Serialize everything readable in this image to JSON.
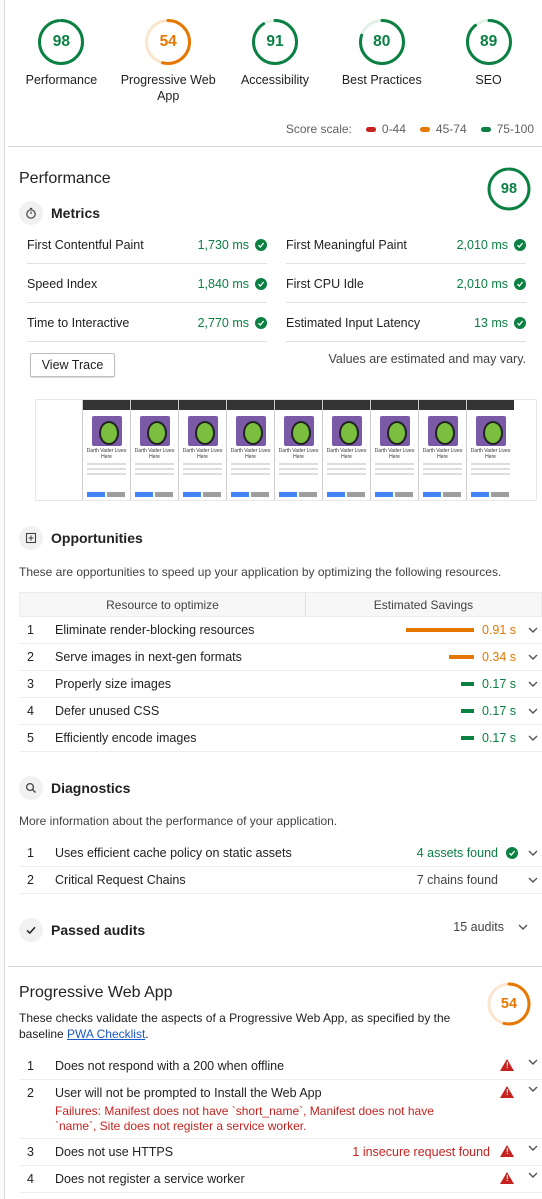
{
  "gauges": [
    {
      "score": "98",
      "label": "Performance",
      "color": "#0b8043",
      "pct": 0.98
    },
    {
      "score": "54",
      "label": "Progressive Web App",
      "color": "#e67700",
      "pct": 0.54
    },
    {
      "score": "91",
      "label": "Accessibility",
      "color": "#0b8043",
      "pct": 0.91
    },
    {
      "score": "80",
      "label": "Best Practices",
      "color": "#0b8043",
      "pct": 0.8
    },
    {
      "score": "89",
      "label": "SEO",
      "color": "#0b8043",
      "pct": 0.89
    }
  ],
  "scale": {
    "title": "Score scale:",
    "fail": "0-44",
    "average": "45-74",
    "pass": "75-100",
    "fail_color": "#c7221f",
    "average_color": "#e67700",
    "pass_color": "#0b8043"
  },
  "performance": {
    "title": "Performance",
    "score": "98",
    "pct": 0.98,
    "metrics_title": "Metrics",
    "metrics": [
      {
        "name": "First Contentful Paint",
        "value": "1,730 ms"
      },
      {
        "name": "First Meaningful Paint",
        "value": "2,010 ms"
      },
      {
        "name": "Speed Index",
        "value": "1,840 ms"
      },
      {
        "name": "First CPU Idle",
        "value": "2,010 ms"
      },
      {
        "name": "Time to Interactive",
        "value": "2,770 ms"
      },
      {
        "name": "Estimated Input Latency",
        "value": "13 ms"
      }
    ],
    "view_trace": "View Trace",
    "estimate_note": "Values are estimated and may vary.",
    "frame_title": "Darth Vader Lives Here"
  },
  "opportunities": {
    "title": "Opportunities",
    "desc": "These are opportunities to speed up your application by optimizing the following resources.",
    "col1": "Resource to optimize",
    "col2": "Estimated Savings",
    "items": [
      {
        "n": "1",
        "title": "Eliminate render-blocking resources",
        "saving": "0.91 s",
        "level": "average",
        "fraction": 1.0
      },
      {
        "n": "2",
        "title": "Serve images in next-gen formats",
        "saving": "0.34 s",
        "level": "average",
        "fraction": 0.37
      },
      {
        "n": "3",
        "title": "Properly size images",
        "saving": "0.17 s",
        "level": "pass",
        "fraction": 0.19
      },
      {
        "n": "4",
        "title": "Defer unused CSS",
        "saving": "0.17 s",
        "level": "pass",
        "fraction": 0.19
      },
      {
        "n": "5",
        "title": "Efficiently encode images",
        "saving": "0.17 s",
        "level": "pass",
        "fraction": 0.19
      }
    ]
  },
  "diagnostics": {
    "title": "Diagnostics",
    "desc": "More information about the performance of your application.",
    "items": [
      {
        "n": "1",
        "title": "Uses efficient cache policy on static assets",
        "detail": "4 assets found"
      },
      {
        "n": "2",
        "title": "Critical Request Chains",
        "detail": "7 chains found"
      }
    ]
  },
  "passed": {
    "title": "Passed audits",
    "count": "15 audits"
  },
  "pwa": {
    "title": "Progressive Web App",
    "score": "54",
    "pct": 0.54,
    "desc1": "These checks validate the aspects of a Progressive Web App, as specified by the baseline ",
    "link": "PWA Checklist",
    "desc2": ".",
    "items": [
      {
        "n": "1",
        "title": "Does not respond with a 200 when offline"
      },
      {
        "n": "2",
        "title": "User will not be prompted to Install the Web App",
        "failure": "Failures: Manifest does not have `short_name`, Manifest does not have `name`, Site does not register a service worker."
      },
      {
        "n": "3",
        "title": "Does not use HTTPS",
        "detail": "1 insecure request found"
      },
      {
        "n": "4",
        "title": "Does not register a service worker"
      }
    ]
  }
}
